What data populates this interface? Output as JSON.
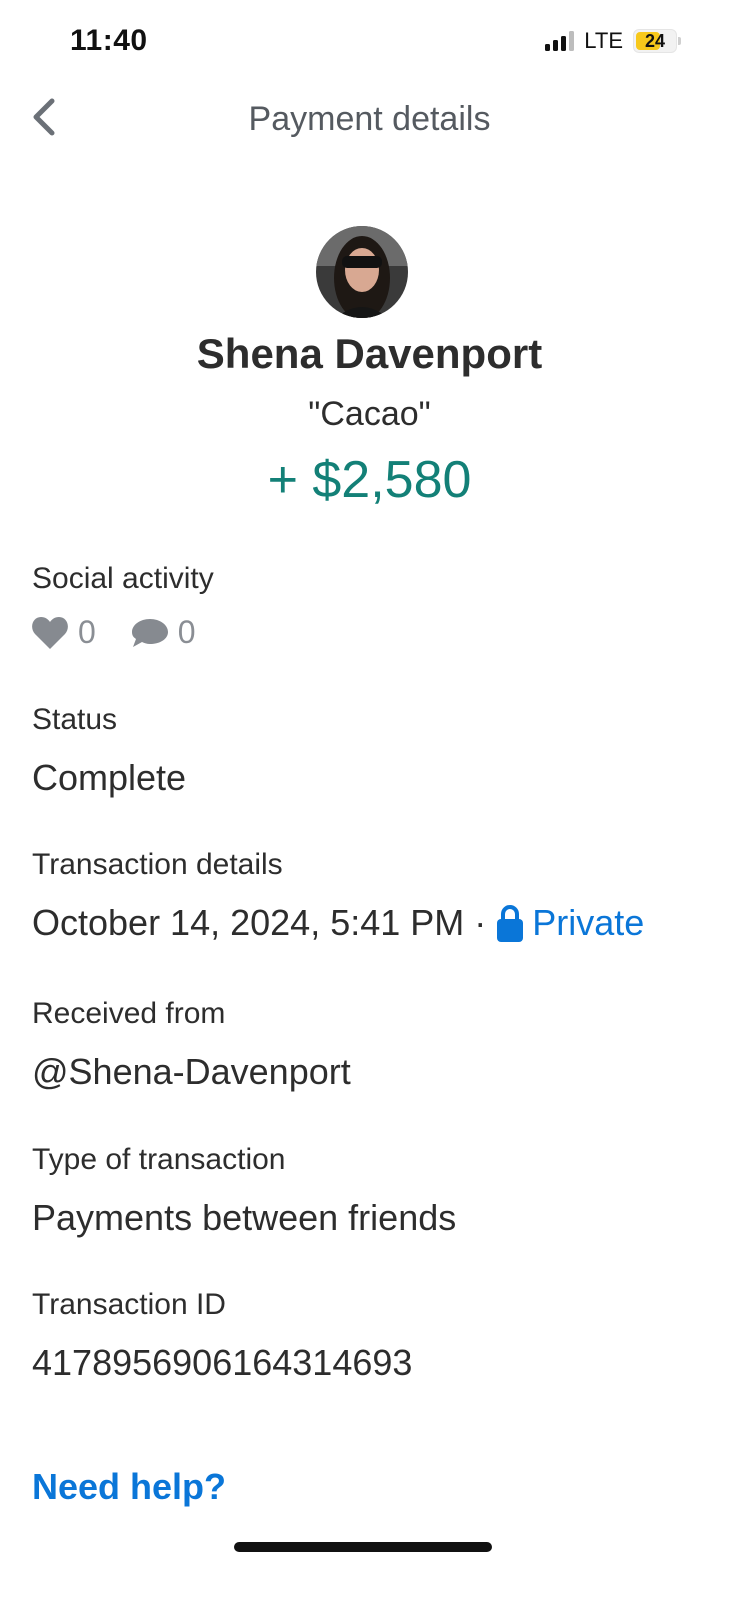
{
  "status_bar": {
    "time": "11:40",
    "network": "LTE",
    "battery": "24"
  },
  "header": {
    "title": "Payment details",
    "back_icon": "chevron-left-icon"
  },
  "profile": {
    "name": "Shena Davenport",
    "note": "\"Cacao\"",
    "amount": "+ $2,580",
    "amount_color": "#138077"
  },
  "social": {
    "label": "Social activity",
    "likes": "0",
    "comments": "0"
  },
  "status": {
    "label": "Status",
    "value": "Complete"
  },
  "transaction_details": {
    "label": "Transaction details",
    "datetime": "October 14, 2024, 5:41 PM",
    "separator": "·",
    "privacy": "Private",
    "privacy_color": "#0a76d8"
  },
  "received_from": {
    "label": "Received from",
    "value": "@Shena-Davenport"
  },
  "transaction_type": {
    "label": "Type of transaction",
    "value": "Payments between friends"
  },
  "transaction_id": {
    "label": "Transaction ID",
    "value": "4178956906164314693"
  },
  "help": {
    "label": "Need help?"
  }
}
